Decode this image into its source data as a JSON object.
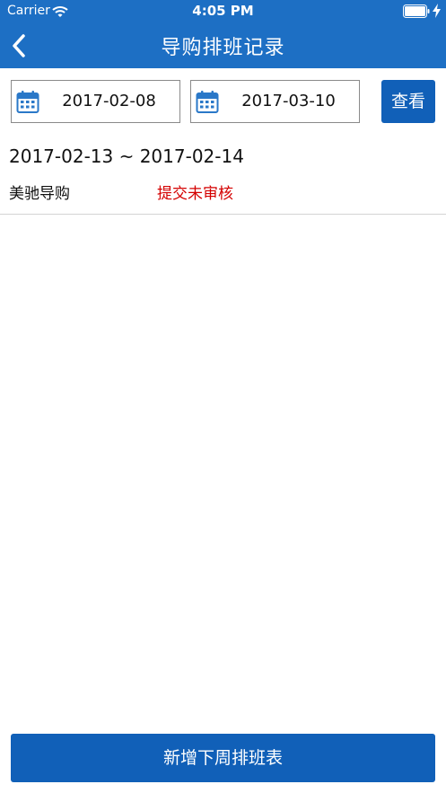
{
  "status_bar": {
    "carrier": "Carrier",
    "time": "4:05 PM",
    "icons": [
      "wifi-icon",
      "battery-icon",
      "charging-icon"
    ]
  },
  "nav": {
    "title": "导购排班记录",
    "back_icon": "chevron-left-icon"
  },
  "filter": {
    "start_date": "2017-02-08",
    "end_date": "2017-03-10",
    "date_icon": "calendar-icon",
    "view_button_label": "查看"
  },
  "records": [
    {
      "date_range": "2017-02-13 ~ 2017-02-14",
      "name": "美驰导购",
      "status": "提交未审核"
    }
  ],
  "footer": {
    "add_button_label": "新增下周排班表"
  },
  "colors": {
    "primary": "#1d6fc4",
    "button": "#1160b8",
    "status_pending": "#d40000"
  }
}
